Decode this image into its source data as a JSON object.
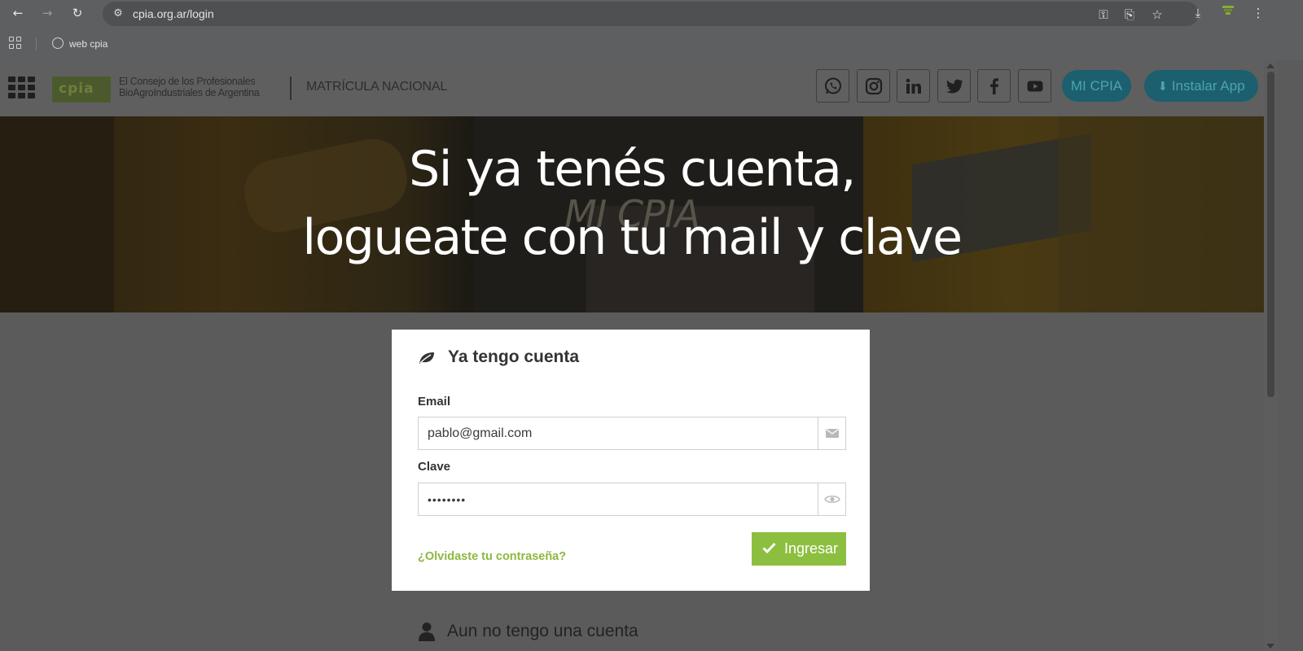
{
  "browser": {
    "url": "cpia.org.ar/login",
    "bookmarks": [
      {
        "label": "web cpia"
      }
    ]
  },
  "header": {
    "logo_text": "cpia",
    "org_line1": "El Consejo de los Profesionales",
    "org_line2": "BioAgroIndustriales de Argentina",
    "subtitle": "MATRÍCULA NACIONAL",
    "social": [
      "whatsapp-icon",
      "instagram-icon",
      "linkedin-icon",
      "twitter-icon",
      "facebook-icon",
      "youtube-icon"
    ],
    "mi_cpia_label": "MI CPIA",
    "install_label": "Instalar App"
  },
  "hero": {
    "line1": "Si ya tenés cuenta,",
    "line2": "logueate con tu mail y clave",
    "ghost": "MI CPIA"
  },
  "login": {
    "title": "Ya tengo cuenta",
    "email_label": "Email",
    "email_value": "pablo@gmail.com",
    "password_label": "Clave",
    "password_value": "••••••••",
    "forgot_label": "¿Olvidaste tu contraseña?",
    "submit_label": "Ingresar"
  },
  "register": {
    "title": "Aun no tengo una cuenta"
  },
  "colors": {
    "accent_green": "#8cbf3f",
    "brand_teal": "#1c5f6e"
  }
}
